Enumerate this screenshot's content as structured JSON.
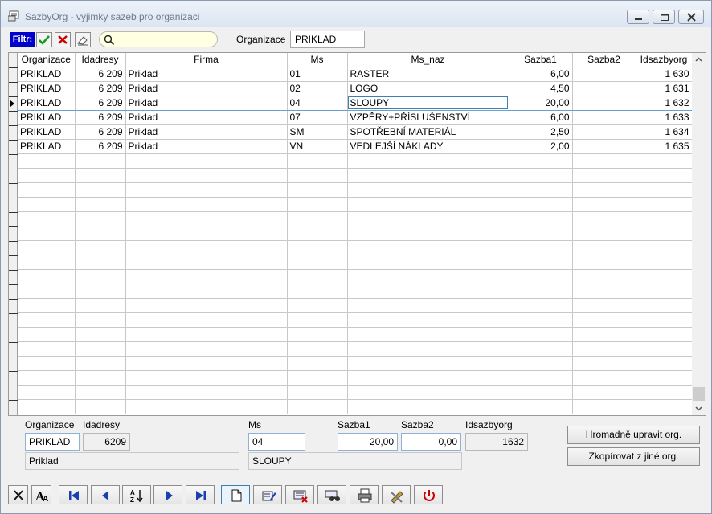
{
  "window": {
    "title": "SazbyOrg - výjimky sazeb pro organizaci"
  },
  "filter": {
    "label": "Filtr:",
    "search_value": "",
    "organizace_label": "Organizace",
    "organizace_value": "PRIKLAD"
  },
  "grid": {
    "columns": [
      "Organizace",
      "Idadresy",
      "Firma",
      "Ms",
      "Ms_naz",
      "Sazba1",
      "Sazba2",
      "Idsazbyorg"
    ],
    "rows": [
      [
        "PRIKLAD",
        "6 209",
        "Priklad",
        "01",
        "RASTER",
        "6,00",
        "",
        "1 630"
      ],
      [
        "PRIKLAD",
        "6 209",
        "Priklad",
        "02",
        "LOGO",
        "4,50",
        "",
        "1 631"
      ],
      [
        "PRIKLAD",
        "6 209",
        "Priklad",
        "04",
        "SLOUPY",
        "20,00",
        "",
        "1 632"
      ],
      [
        "PRIKLAD",
        "6 209",
        "Priklad",
        "07",
        "VZPĚRY+PŘÍSLUŠENSTVÍ",
        "6,00",
        "",
        "1 633"
      ],
      [
        "PRIKLAD",
        "6 209",
        "Priklad",
        "SM",
        "SPOTŘEBNÍ MATERIÁL",
        "2,50",
        "",
        "1 634"
      ],
      [
        "PRIKLAD",
        "6 209",
        "Priklad",
        "VN",
        "VEDLEJŠÍ NÁKLADY",
        "2,00",
        "",
        "1 635"
      ]
    ],
    "selected_row": 2
  },
  "detail": {
    "organizace_label": "Organizace",
    "organizace_value": "PRIKLAD",
    "idadresy_label": "Idadresy",
    "idadresy_value": "6209",
    "firma_value": "Priklad",
    "ms_label": "Ms",
    "ms_value": "04",
    "ms_naz_value": "SLOUPY",
    "sazba1_label": "Sazba1",
    "sazba1_value": "20,00",
    "sazba2_label": "Sazba2",
    "sazba2_value": "0,00",
    "idsazbyorg_label": "Idsazbyorg",
    "idsazbyorg_value": "1632",
    "bulk_edit_button": "Hromadně upravit org.",
    "copy_button": "Zkopírovat z jiné org."
  },
  "colors": {
    "filter_label_bg": "#0000cc",
    "search_bg": "#ffffe1",
    "delete_red": "#cc0000",
    "nav_blue": "#1a3fb0"
  },
  "toolbar_icons": [
    "close-filter-icon",
    "font-icon",
    "first-record-icon",
    "previous-record-icon",
    "sort-icon",
    "next-record-icon",
    "last-record-icon",
    "new-record-icon",
    "edit-record-icon",
    "delete-record-icon",
    "find-icon",
    "print-icon",
    "tools-icon",
    "power-icon"
  ]
}
